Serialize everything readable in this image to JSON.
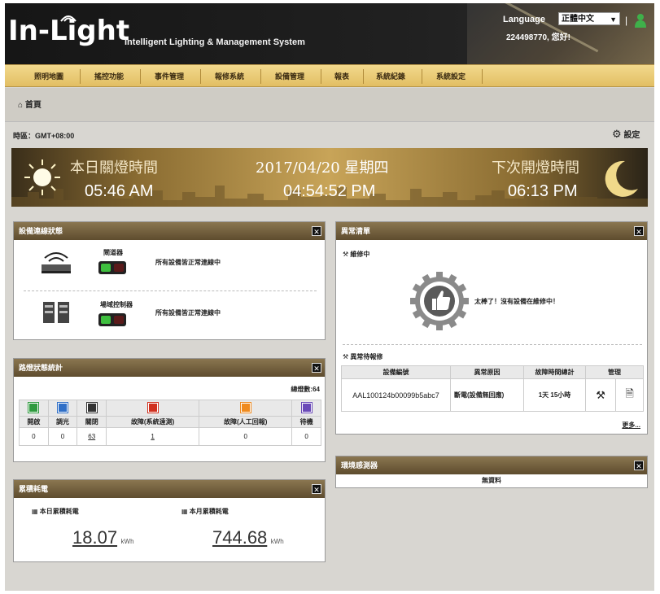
{
  "header": {
    "logo": "In-Light",
    "subtitle": "Intelligent Lighting & Management System",
    "language_label": "Language",
    "language_value": "正體中文",
    "separator": "|",
    "user_greeting": "224498770, 您好!"
  },
  "nav": {
    "items": [
      "照明地圖",
      "搖控功能",
      "事件管理",
      "報修系統",
      "設備管理",
      "報表",
      "系統紀錄",
      "系統設定"
    ]
  },
  "breadcrumb": "首頁",
  "timezone": "時區：GMT+08:00",
  "settings_label": "設定",
  "banner": {
    "off_label": "本日關燈時間",
    "off_time": "05:46 AM",
    "date_label": "2017/04/20 星期四",
    "current_time": "04:54:52 PM",
    "on_label": "下次開燈時間",
    "on_time": "06:13 PM"
  },
  "device_panel": {
    "title": "設備連線狀態",
    "rows": [
      {
        "name": "閘道器",
        "status": "所有設備皆正常連線中",
        "icon": "router-icon"
      },
      {
        "name": "場域控制器",
        "status": "所有設備皆正常連線中",
        "icon": "controller-icon"
      }
    ]
  },
  "light_panel": {
    "title": "路燈狀態統計",
    "total_label": "總燈數:",
    "total_value": "64",
    "columns": [
      "開啟",
      "調光",
      "關閉",
      "故障(系統遠測)",
      "故障(人工回報)",
      "待機"
    ],
    "values": [
      "0",
      "0",
      "63",
      "1",
      "0",
      "0"
    ],
    "colors": [
      "#2e9a3e",
      "#2f6fc7",
      "#333333",
      "#d0301f",
      "#ef8a1e",
      "#6a4ab8"
    ]
  },
  "energy_panel": {
    "title": "累積耗電",
    "day_label": "本日累積耗電",
    "day_value": "18.07",
    "month_label": "本月累積耗電",
    "month_value": "744.68",
    "unit": "kWh"
  },
  "alert_panel": {
    "title": "異常清單",
    "repair_label": "維修中",
    "repair_message": "太棒了！沒有設備在維修中！",
    "pending_label": "異常待報修",
    "columns": [
      "設備編號",
      "異常原因",
      "故障時間總計",
      "管理"
    ],
    "row": {
      "device": "AAL100124b00099b5abc7",
      "reason": "斷電(設備無回應)",
      "duration": "1天 15小時"
    },
    "more": "更多..."
  },
  "env_panel": {
    "title": "環境感測器",
    "empty": "無資料"
  }
}
